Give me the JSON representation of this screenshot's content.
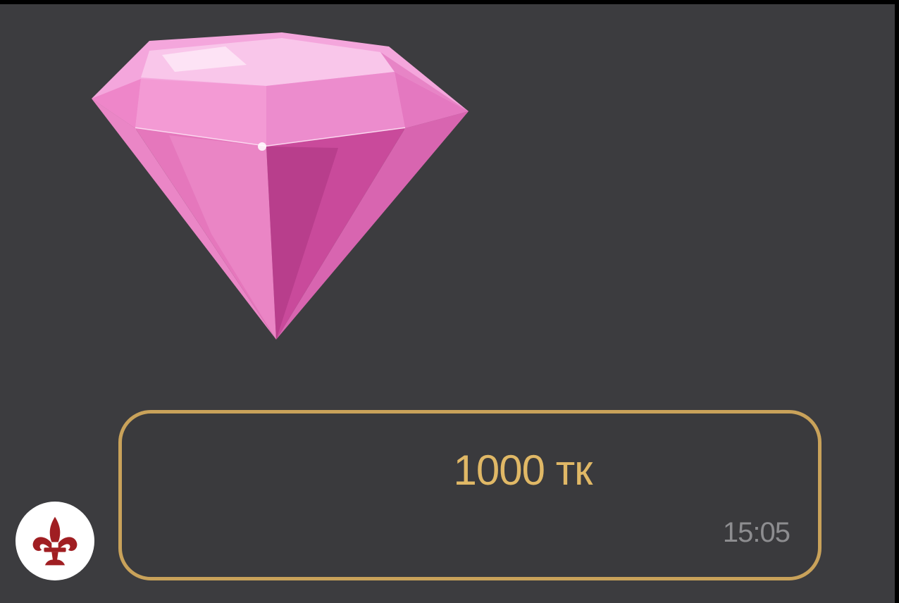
{
  "message": {
    "sticker_icon": "pink-diamond-icon",
    "amount": "1000 тк",
    "time": "15:05"
  },
  "sender": {
    "avatar_icon": "fleur-de-lis-icon"
  },
  "colors": {
    "panel_background": "#3c3c3f",
    "bubble_border": "#c9a25a",
    "amount_text": "#e0b866",
    "time_text": "#8d8d90",
    "avatar_symbol": "#a01e22"
  }
}
